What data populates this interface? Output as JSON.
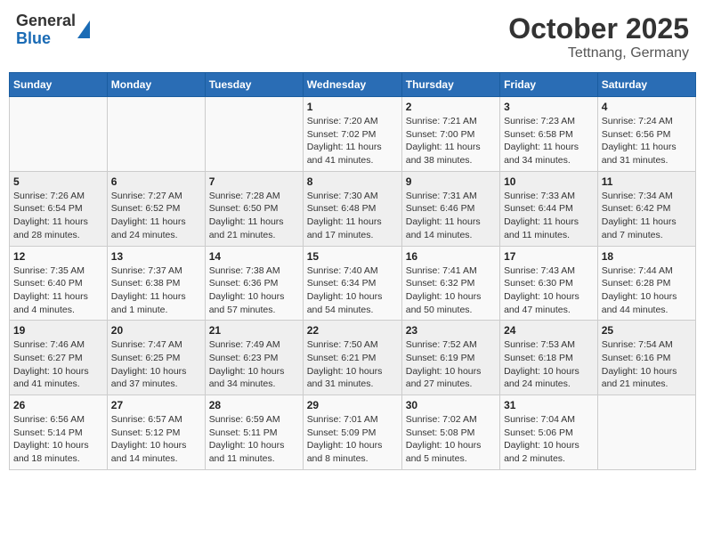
{
  "header": {
    "title": "October 2025",
    "subtitle": "Tettnang, Germany"
  },
  "logo": {
    "line1": "General",
    "line2": "Blue"
  },
  "days_of_week": [
    "Sunday",
    "Monday",
    "Tuesday",
    "Wednesday",
    "Thursday",
    "Friday",
    "Saturday"
  ],
  "weeks": [
    [
      {
        "date": "",
        "info": ""
      },
      {
        "date": "",
        "info": ""
      },
      {
        "date": "",
        "info": ""
      },
      {
        "date": "1",
        "info": "Sunrise: 7:20 AM\nSunset: 7:02 PM\nDaylight: 11 hours and 41 minutes."
      },
      {
        "date": "2",
        "info": "Sunrise: 7:21 AM\nSunset: 7:00 PM\nDaylight: 11 hours and 38 minutes."
      },
      {
        "date": "3",
        "info": "Sunrise: 7:23 AM\nSunset: 6:58 PM\nDaylight: 11 hours and 34 minutes."
      },
      {
        "date": "4",
        "info": "Sunrise: 7:24 AM\nSunset: 6:56 PM\nDaylight: 11 hours and 31 minutes."
      }
    ],
    [
      {
        "date": "5",
        "info": "Sunrise: 7:26 AM\nSunset: 6:54 PM\nDaylight: 11 hours and 28 minutes."
      },
      {
        "date": "6",
        "info": "Sunrise: 7:27 AM\nSunset: 6:52 PM\nDaylight: 11 hours and 24 minutes."
      },
      {
        "date": "7",
        "info": "Sunrise: 7:28 AM\nSunset: 6:50 PM\nDaylight: 11 hours and 21 minutes."
      },
      {
        "date": "8",
        "info": "Sunrise: 7:30 AM\nSunset: 6:48 PM\nDaylight: 11 hours and 17 minutes."
      },
      {
        "date": "9",
        "info": "Sunrise: 7:31 AM\nSunset: 6:46 PM\nDaylight: 11 hours and 14 minutes."
      },
      {
        "date": "10",
        "info": "Sunrise: 7:33 AM\nSunset: 6:44 PM\nDaylight: 11 hours and 11 minutes."
      },
      {
        "date": "11",
        "info": "Sunrise: 7:34 AM\nSunset: 6:42 PM\nDaylight: 11 hours and 7 minutes."
      }
    ],
    [
      {
        "date": "12",
        "info": "Sunrise: 7:35 AM\nSunset: 6:40 PM\nDaylight: 11 hours and 4 minutes."
      },
      {
        "date": "13",
        "info": "Sunrise: 7:37 AM\nSunset: 6:38 PM\nDaylight: 11 hours and 1 minute."
      },
      {
        "date": "14",
        "info": "Sunrise: 7:38 AM\nSunset: 6:36 PM\nDaylight: 10 hours and 57 minutes."
      },
      {
        "date": "15",
        "info": "Sunrise: 7:40 AM\nSunset: 6:34 PM\nDaylight: 10 hours and 54 minutes."
      },
      {
        "date": "16",
        "info": "Sunrise: 7:41 AM\nSunset: 6:32 PM\nDaylight: 10 hours and 50 minutes."
      },
      {
        "date": "17",
        "info": "Sunrise: 7:43 AM\nSunset: 6:30 PM\nDaylight: 10 hours and 47 minutes."
      },
      {
        "date": "18",
        "info": "Sunrise: 7:44 AM\nSunset: 6:28 PM\nDaylight: 10 hours and 44 minutes."
      }
    ],
    [
      {
        "date": "19",
        "info": "Sunrise: 7:46 AM\nSunset: 6:27 PM\nDaylight: 10 hours and 41 minutes."
      },
      {
        "date": "20",
        "info": "Sunrise: 7:47 AM\nSunset: 6:25 PM\nDaylight: 10 hours and 37 minutes."
      },
      {
        "date": "21",
        "info": "Sunrise: 7:49 AM\nSunset: 6:23 PM\nDaylight: 10 hours and 34 minutes."
      },
      {
        "date": "22",
        "info": "Sunrise: 7:50 AM\nSunset: 6:21 PM\nDaylight: 10 hours and 31 minutes."
      },
      {
        "date": "23",
        "info": "Sunrise: 7:52 AM\nSunset: 6:19 PM\nDaylight: 10 hours and 27 minutes."
      },
      {
        "date": "24",
        "info": "Sunrise: 7:53 AM\nSunset: 6:18 PM\nDaylight: 10 hours and 24 minutes."
      },
      {
        "date": "25",
        "info": "Sunrise: 7:54 AM\nSunset: 6:16 PM\nDaylight: 10 hours and 21 minutes."
      }
    ],
    [
      {
        "date": "26",
        "info": "Sunrise: 6:56 AM\nSunset: 5:14 PM\nDaylight: 10 hours and 18 minutes."
      },
      {
        "date": "27",
        "info": "Sunrise: 6:57 AM\nSunset: 5:12 PM\nDaylight: 10 hours and 14 minutes."
      },
      {
        "date": "28",
        "info": "Sunrise: 6:59 AM\nSunset: 5:11 PM\nDaylight: 10 hours and 11 minutes."
      },
      {
        "date": "29",
        "info": "Sunrise: 7:01 AM\nSunset: 5:09 PM\nDaylight: 10 hours and 8 minutes."
      },
      {
        "date": "30",
        "info": "Sunrise: 7:02 AM\nSunset: 5:08 PM\nDaylight: 10 hours and 5 minutes."
      },
      {
        "date": "31",
        "info": "Sunrise: 7:04 AM\nSunset: 5:06 PM\nDaylight: 10 hours and 2 minutes."
      },
      {
        "date": "",
        "info": ""
      }
    ]
  ]
}
